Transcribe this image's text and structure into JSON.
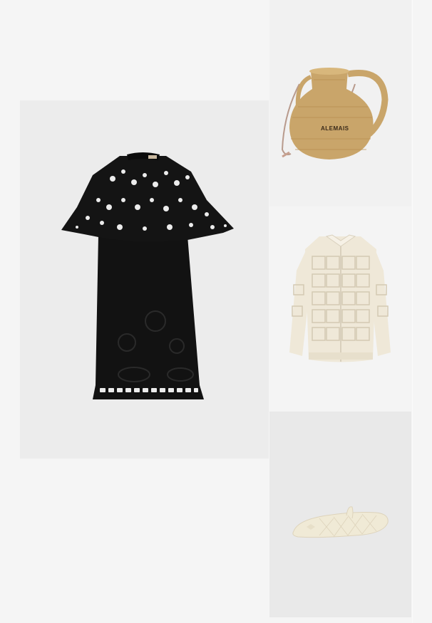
{
  "products": [
    {
      "name": "black-eyelet-cape-dress",
      "icon": "dress-image"
    },
    {
      "name": "woven-vase-bag",
      "icon": "bag-image",
      "brand_text": "ALEMAIS"
    },
    {
      "name": "cream-crochet-cardigan",
      "icon": "cardigan-image"
    },
    {
      "name": "cream-quilted-ballet-flat",
      "icon": "flat-image"
    }
  ],
  "colors": {
    "background": "#f5f5f5",
    "dress": "#121212",
    "bag": "#c9a56a",
    "cardigan": "#efe8d8",
    "flat": "#f0ead6"
  }
}
